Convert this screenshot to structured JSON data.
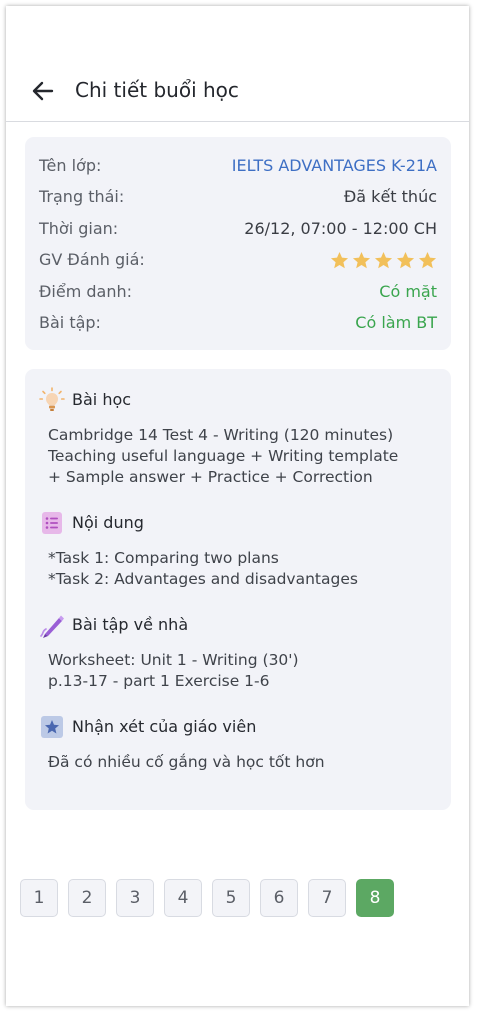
{
  "header": {
    "title": "Chi tiết buổi học"
  },
  "info": {
    "class_label": "Tên lớp:",
    "class_value": "IELTS ADVANTAGES K-21A",
    "status_label": "Trạng thái:",
    "status_value": "Đã kết thúc",
    "time_label": "Thời gian:",
    "time_value": "26/12, 07:00 - 12:00 CH",
    "rating_label": "GV Đánh giá:",
    "rating_stars": 5,
    "attendance_label": "Điểm danh:",
    "attendance_value": "Có mặt",
    "homework_label": "Bài tập:",
    "homework_value": "Có làm BT"
  },
  "sections": {
    "lesson": {
      "title": "Bài học",
      "body": "Cambridge 14 Test 4 - Writing (120 minutes)\nTeaching useful language + Writing template\n+ Sample answer + Practice + Correction"
    },
    "content": {
      "title": "Nội dung",
      "body": "*Task 1: Comparing two plans\n*Task 2: Advantages and disadvantages"
    },
    "homework": {
      "title": "Bài tập về nhà",
      "body": "Worksheet: Unit 1 - Writing (30')\np.13-17 -  part 1 Exercise 1-6"
    },
    "teacher_comment": {
      "title": "Nhận xét của giáo viên",
      "body": "Đã có nhiều cố gắng và học tốt hơn"
    }
  },
  "pagination": {
    "pages": [
      "1",
      "2",
      "3",
      "4",
      "5",
      "6",
      "7",
      "8"
    ],
    "current": "8"
  },
  "colors": {
    "accent_blue": "#3e6fc4",
    "green": "#3aa54e",
    "star": "#f2c05a",
    "active_page": "#5ca863"
  }
}
